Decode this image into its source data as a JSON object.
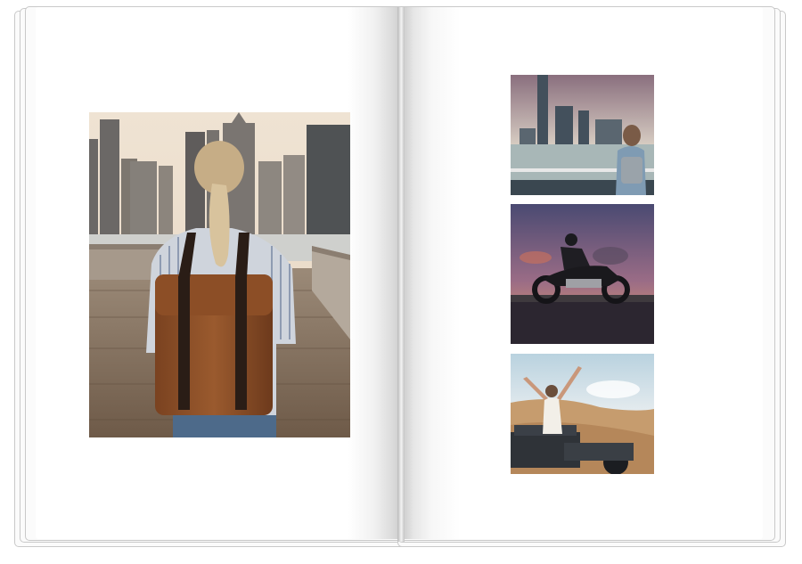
{
  "album": {
    "left_page": {
      "photo": {
        "subject": "woman-with-backpack-city-pier"
      }
    },
    "right_page": {
      "photos": [
        {
          "subject": "woman-overlooking-city-skyline"
        },
        {
          "subject": "motorcyclist-at-sunset"
        },
        {
          "subject": "woman-on-jeep-arms-raised"
        }
      ]
    }
  },
  "colors": {
    "page": "#ffffff",
    "page_edge": "#c9c9c9",
    "spine_shadow": "#b9b9b9"
  }
}
